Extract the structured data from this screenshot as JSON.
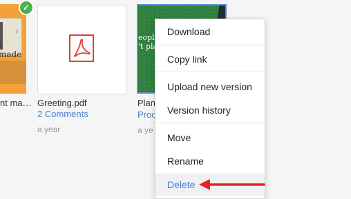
{
  "files": [
    {
      "name": "nt ma…",
      "thumbnail_text": "t made",
      "status": "synced"
    },
    {
      "name": "Greeting.pdf",
      "comments": "2 Comments",
      "modified": "a year",
      "icon": "pdf-icon"
    },
    {
      "name": "Plan",
      "subtitle": "Proc",
      "modified": "a ye",
      "thumbnail_text": "eople\n't plan"
    }
  ],
  "context_menu": {
    "items": [
      {
        "label": "Download"
      },
      {
        "label": "Copy link"
      },
      {
        "label": "Upload new version"
      },
      {
        "label": "Version history"
      },
      {
        "label": "Move"
      },
      {
        "label": "Rename"
      },
      {
        "label": "Delete"
      }
    ],
    "highlighted": "Delete"
  },
  "colors": {
    "accent": "#4a7fd4",
    "annotation_arrow": "#e8231f",
    "pdf_red": "#d9423a",
    "synced_badge": "#4caf50"
  }
}
